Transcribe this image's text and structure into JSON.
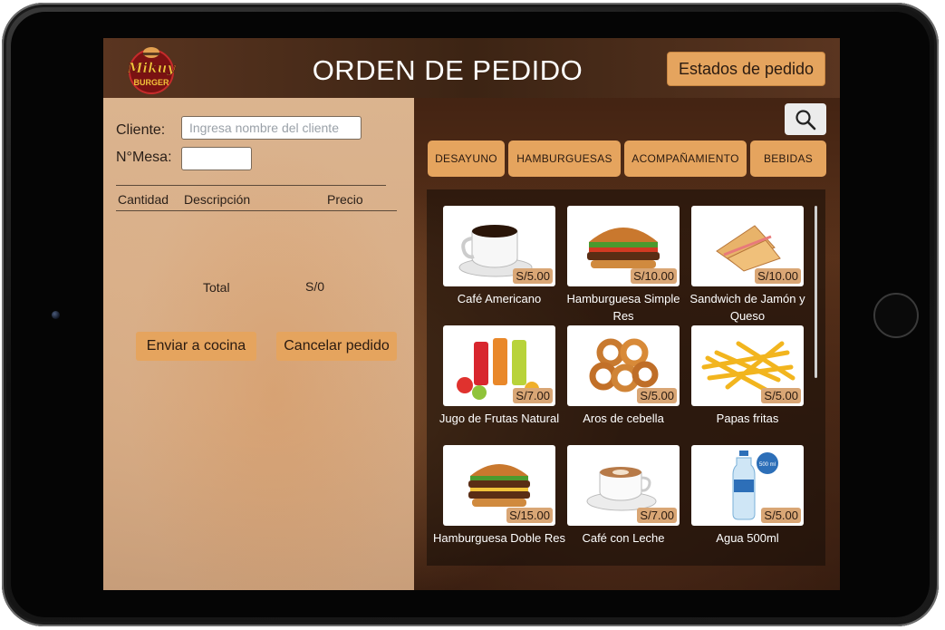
{
  "app": {
    "logo_text_top": "Mikuy",
    "logo_text_bottom": "BURGER"
  },
  "header": {
    "title": "ORDEN DE PEDIDO",
    "status_button": "Estados de pedido"
  },
  "order": {
    "client_label": "Cliente:",
    "client_placeholder": "Ingresa nombre del cliente",
    "client_value": "",
    "table_label": "N°Mesa:",
    "table_value": "",
    "columns": {
      "qty": "Cantidad",
      "desc": "Descripción",
      "price": "Precio"
    },
    "total_label": "Total",
    "total_value": "S/0",
    "send_button": "Enviar a cocina",
    "cancel_button": "Cancelar pedido"
  },
  "categories": [
    "DESAYUNO",
    "HAMBURGUESAS",
    "ACOMPAÑAMIENTO",
    "BEBIDAS"
  ],
  "search": {
    "icon": "search-icon"
  },
  "products": [
    {
      "name": "Café Americano",
      "price": "S/5.00",
      "image": "coffee-cup"
    },
    {
      "name": "Hamburguesa Simple Res",
      "price": "S/10.00",
      "image": "burger"
    },
    {
      "name": "Sandwich de Jamón y Queso",
      "price": "S/10.00",
      "image": "sandwich"
    },
    {
      "name": "Jugo de Frutas Natural",
      "price": "S/7.00",
      "image": "juice-bottles"
    },
    {
      "name": "Aros de cebella",
      "price": "S/5.00",
      "image": "onion-rings"
    },
    {
      "name": "Papas fritas",
      "price": "S/5.00",
      "image": "french-fries"
    },
    {
      "name": "Hamburguesa Doble Res",
      "price": "S/15.00",
      "image": "double-burger"
    },
    {
      "name": "Café con Leche",
      "price": "S/7.00",
      "image": "latte"
    },
    {
      "name": "Agua 500ml",
      "price": "S/5.00",
      "image": "water-bottle",
      "badge": "500 ml"
    }
  ]
}
